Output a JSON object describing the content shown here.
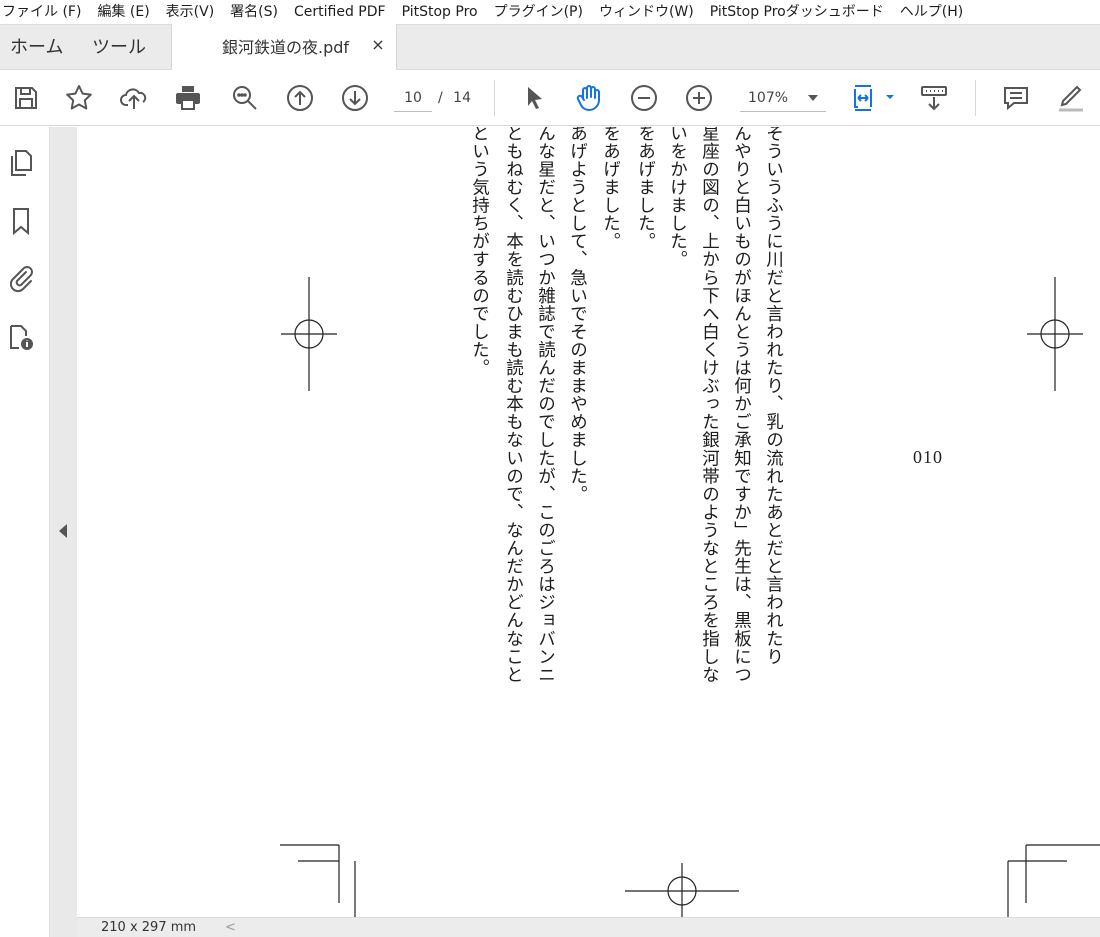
{
  "menu": {
    "items": [
      "ファイル (F)",
      "編集 (E)",
      "表示(V)",
      "署名(S)",
      "Certified PDF",
      "PitStop Pro",
      "プラグイン(P)",
      "ウィンドウ(W)",
      "PitStop Proダッシュボード",
      "ヘルプ(H)"
    ]
  },
  "tabs": {
    "home": "ホーム",
    "tools": "ツール",
    "document": "銀河鉄道の夜.pdf",
    "close": "×"
  },
  "toolbar": {
    "page_current": "10",
    "page_total": "/ 14",
    "zoom": "107%",
    "icons": [
      "save-icon",
      "bookmark-star-icon",
      "cloud-upload-icon",
      "print-icon",
      "search-zoom-icon",
      "page-up-icon",
      "page-down-icon",
      "select-arrow-icon",
      "hand-tool-icon",
      "zoom-out-icon",
      "zoom-in-icon",
      "fit-page-icon",
      "scroll-mode-icon",
      "comment-icon",
      "highlight-pen-icon"
    ],
    "active_color": "#1473e6"
  },
  "sidebar": {
    "icons": [
      "pages-thumbnails-icon",
      "bookmarks-icon",
      "attachments-icon",
      "document-properties-icon"
    ]
  },
  "document": {
    "lines": [
      "そういうふうに川だと言われたり、乳の流れたあとだと言われたり",
      "んやりと白いものがほんとうは何かご承知ですか」先生は、黒板につ",
      "星座の図の、上から下へ白くけぶった銀河帯のようなところを指しな",
      "いをかけました。",
      "をあげました。",
      "をあげました。",
      "あげようとして、急いでそのままやめました。",
      "んな星だと、いつか雑誌で読んだのでしたが、このごろはジョバンニ",
      "ともねむく、本を読むひまも読む本もないので、なんだかどんなこと",
      "という気持ちがするのでした。"
    ],
    "page_number": "010"
  },
  "status": {
    "page_size": "210 x 297 mm",
    "scroll_left": "<"
  }
}
